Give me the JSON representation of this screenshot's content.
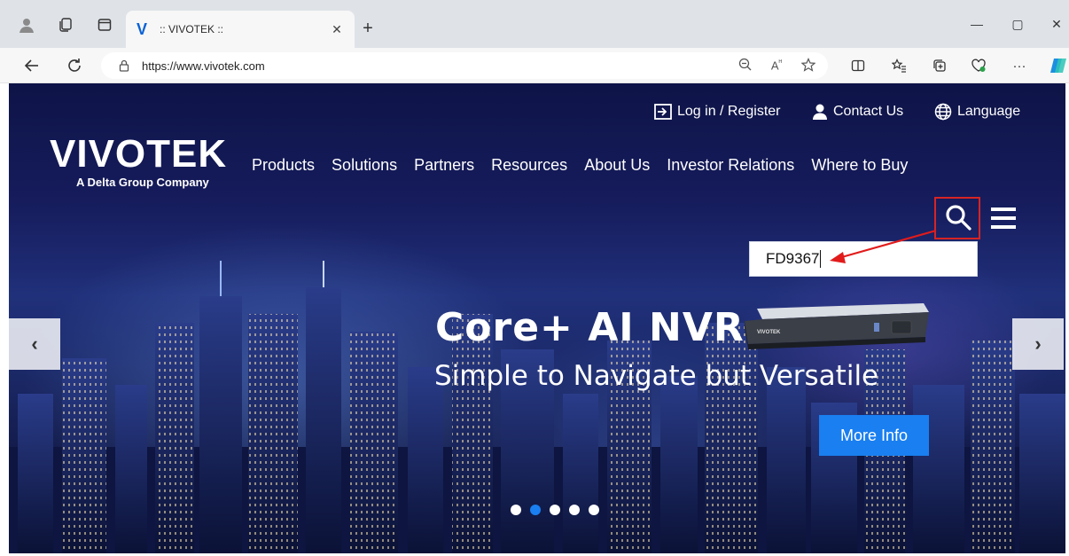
{
  "browser": {
    "tab": {
      "title": ":: VIVOTEK ::",
      "favicon_letter": "V",
      "close_glyph": "✕"
    },
    "new_tab_glyph": "+",
    "window_controls": {
      "minimize": "—",
      "maximize": "▢",
      "close": "✕"
    },
    "url": "https://www.vivotek.com",
    "more_glyph": "···"
  },
  "page": {
    "util_links": [
      {
        "label": "Log in / Register",
        "icon": "login-icon"
      },
      {
        "label": "Contact Us",
        "icon": "user-icon"
      },
      {
        "label": "Language",
        "icon": "globe-icon"
      }
    ],
    "logo": {
      "name": "VIVOTEK",
      "tagline": "A Delta Group Company"
    },
    "nav": [
      "Products",
      "Solutions",
      "Partners",
      "Resources",
      "About Us",
      "Investor Relations",
      "Where to Buy"
    ],
    "search": {
      "value": "FD9367"
    },
    "hero": {
      "title": "Core+ AI NVR",
      "subtitle": "Simple to Navigate but Versatile",
      "button": "More Info",
      "device_brand": "VIVOTEK"
    },
    "carousel": {
      "prev": "‹",
      "next": "›",
      "dot_count": 5,
      "active_index": 1
    },
    "colors": {
      "accent": "#1a7ff0",
      "highlight": "#d62424"
    }
  }
}
